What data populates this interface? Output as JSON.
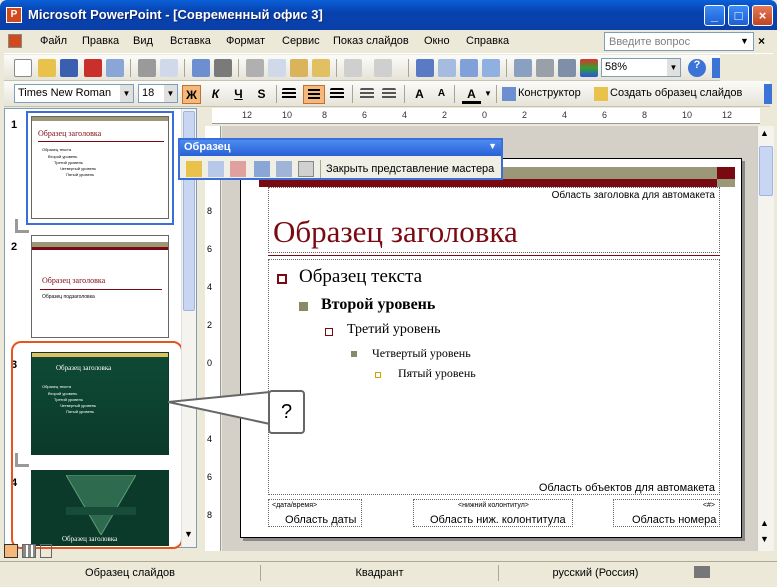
{
  "window": {
    "title": "Microsoft PowerPoint - [Современный офис 3]",
    "app_icon": "P"
  },
  "menu": {
    "items": [
      "Файл",
      "Правка",
      "Вид",
      "Вставка",
      "Формат",
      "Сервис",
      "Показ слайдов",
      "Окно",
      "Справка"
    ],
    "help_placeholder": "Введите вопрос"
  },
  "standard_toolbar": {
    "zoom": "58%"
  },
  "format_toolbar": {
    "font": "Times New Roman",
    "size": "18",
    "bold": "Ж",
    "italic": "К",
    "underline": "Ч",
    "shadow": "S",
    "designer": "Конструктор",
    "create_master": "Создать образец слайдов"
  },
  "master_toolbar": {
    "title": "Образец",
    "close_label": "Закрыть представление мастера"
  },
  "thumbnails": [
    {
      "num": "1",
      "title": "Образец заголовка",
      "lines": [
        "Образец текста",
        "Второй уровень",
        "Третий уровень",
        "Четвертый уровень",
        "Пятый уровень"
      ]
    },
    {
      "num": "2",
      "title": "Образец заголовка",
      "lines": [
        "Образец подзаголовка"
      ]
    },
    {
      "num": "3",
      "title": "Образец заголовка",
      "lines": [
        "Образец текста",
        "Второй уровень",
        "Третий уровень",
        "Четвертый уровень",
        "Пятый уровень"
      ]
    },
    {
      "num": "4",
      "title": "Образец заголовка",
      "lines": []
    }
  ],
  "slide": {
    "title_area_label": "Область заголовка для автомакета",
    "title": "Образец заголовка",
    "levels": [
      "Образец текста",
      "Второй уровень",
      "Третий уровень",
      "Четвертый уровень",
      "Пятый уровень"
    ],
    "object_area_label": "Область объектов для автомакета",
    "footer": {
      "date_tag": "<дата/время>",
      "date_label": "Область даты",
      "footer_tag": "<нижний колонтитул>",
      "footer_label": "Область ниж. колонтитула",
      "number_tag": "<#>",
      "number_label": "Область номера"
    }
  },
  "ruler": {
    "top_ticks": [
      "12",
      "10",
      "8",
      "6",
      "4",
      "2",
      "0",
      "2",
      "4",
      "6",
      "8",
      "10",
      "12"
    ],
    "left_ticks": [
      "8",
      "6",
      "4",
      "2",
      "0",
      "2",
      "4",
      "6",
      "8"
    ]
  },
  "callout": "?",
  "status": {
    "view": "Образец слайдов",
    "design": "Квадрант",
    "language": "русский (Россия)"
  },
  "colors": {
    "accent": "#7a0a12",
    "olive": "#9b9878",
    "dark_green": "#0b3a2a",
    "highlight": "#e8541e"
  }
}
